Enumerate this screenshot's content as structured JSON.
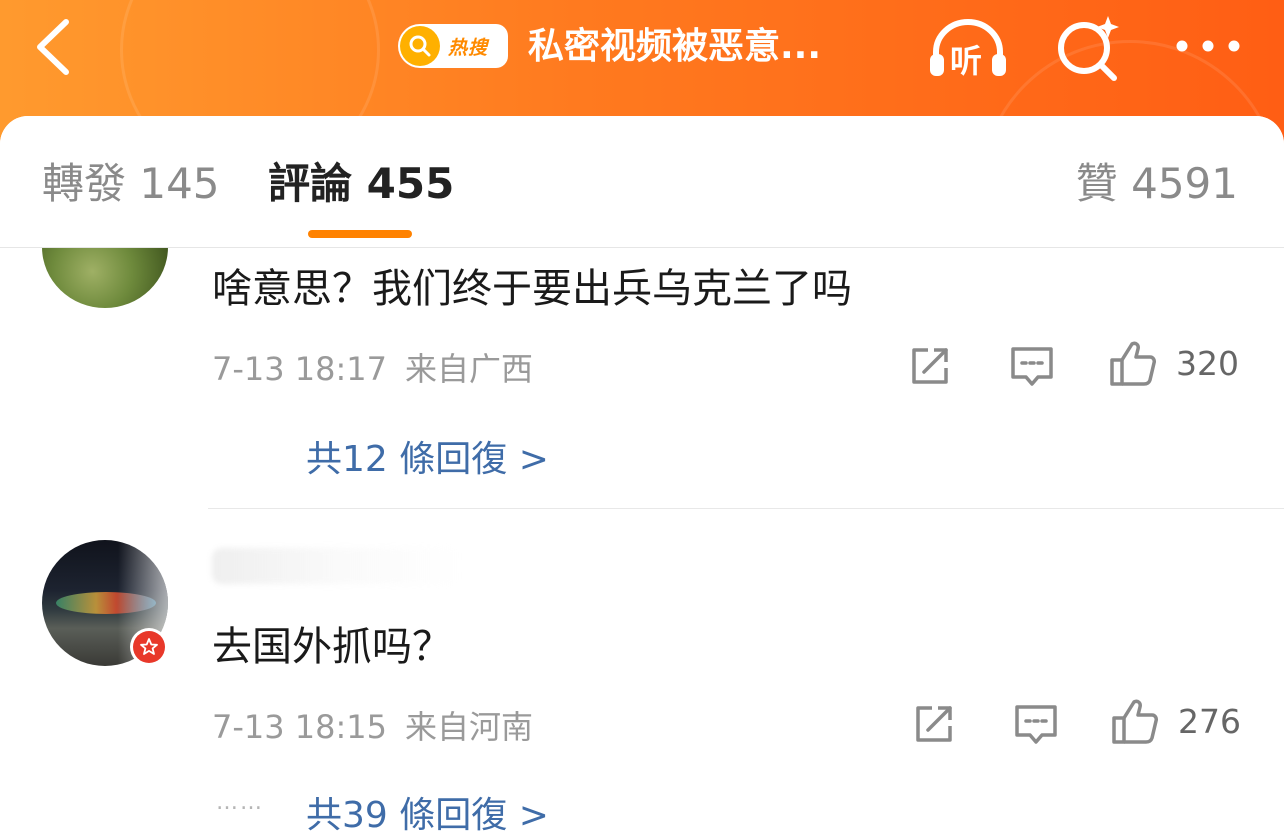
{
  "header": {
    "hot_label": "热搜",
    "topic_title": "私密视频被恶意...",
    "listen_label": "听",
    "icons": [
      "back-arrow-icon",
      "hot-search-icon",
      "headphones-icon",
      "search-sparkle-icon",
      "more-dots-icon"
    ]
  },
  "tabs": {
    "repost": "轉發 145",
    "comment": "評論 455",
    "like": "贊 4591",
    "active": "comment"
  },
  "comments": [
    {
      "text": "啥意思？我们终于要出兵乌克兰了吗",
      "time": "7-13 18:17",
      "location": "来自广西",
      "likes": "320",
      "replies": "共12 條回復 >"
    },
    {
      "text": "去国外抓吗？",
      "time": "7-13 18:15",
      "location": "来自河南",
      "likes": "276",
      "replies": "共39 條回復 >",
      "ellipsis": "……",
      "verified": true
    }
  ],
  "colors": {
    "header_start": "#ff9a2e",
    "header_end": "#ff5e14",
    "tab_underline": "#ff8200",
    "link_blue": "#3f6ca8",
    "verified_red": "#e8382a"
  }
}
